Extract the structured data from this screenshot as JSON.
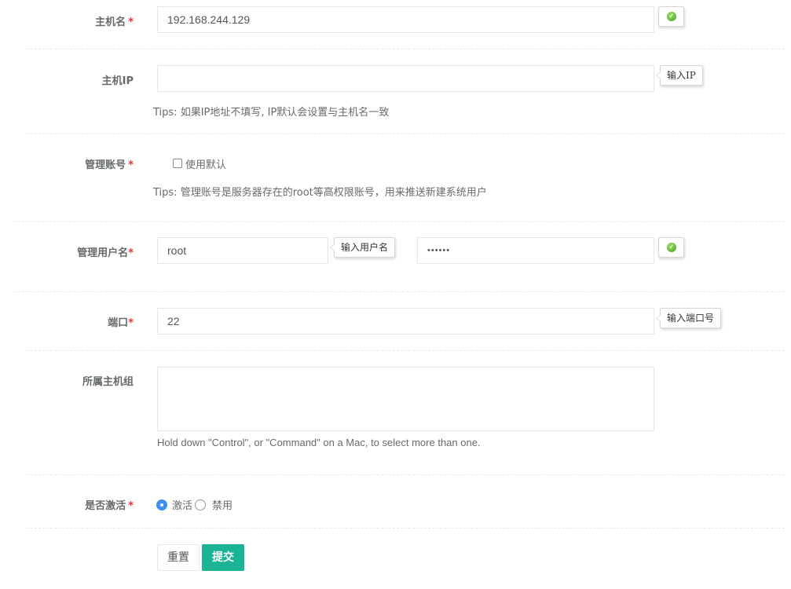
{
  "fields": {
    "hostname": {
      "label": "主机名",
      "required_mark": "*",
      "value": "192.168.244.129"
    },
    "ip": {
      "label": "主机IP",
      "value": "",
      "hint": "输入IP",
      "tips": "Tips: 如果IP地址不填写, IP默认会设置与主机名一致"
    },
    "admin_account": {
      "label": "管理账号",
      "required_mark": "*",
      "use_default_label": "使用默认",
      "use_default_checked": false,
      "tips": "Tips: 管理账号是服务器存在的root等高权限账号，用来推送新建系统用户"
    },
    "admin_user": {
      "label": "管理用户名",
      "required_mark": "*",
      "username_value": "root",
      "username_hint": "输入用户名",
      "password_value": "••••••"
    },
    "port": {
      "label": "端口",
      "required_mark": "*",
      "value": "22",
      "hint": "输入端口号"
    },
    "host_group": {
      "label": "所属主机组",
      "help": "Hold down \"Control\", or \"Command\" on a Mac, to select more than one."
    },
    "active": {
      "label": "是否激活",
      "required_mark": "*",
      "option_active": "激活",
      "option_disabled": "禁用",
      "selected": "激活"
    }
  },
  "buttons": {
    "reset": "重置",
    "submit": "提交"
  },
  "colors": {
    "required": "#e3342f",
    "submit": "#1ab394",
    "radio_selected": "#3d8ff0",
    "valid": "#3f9e1e"
  },
  "icons": {
    "valid": "check-circle-icon"
  }
}
